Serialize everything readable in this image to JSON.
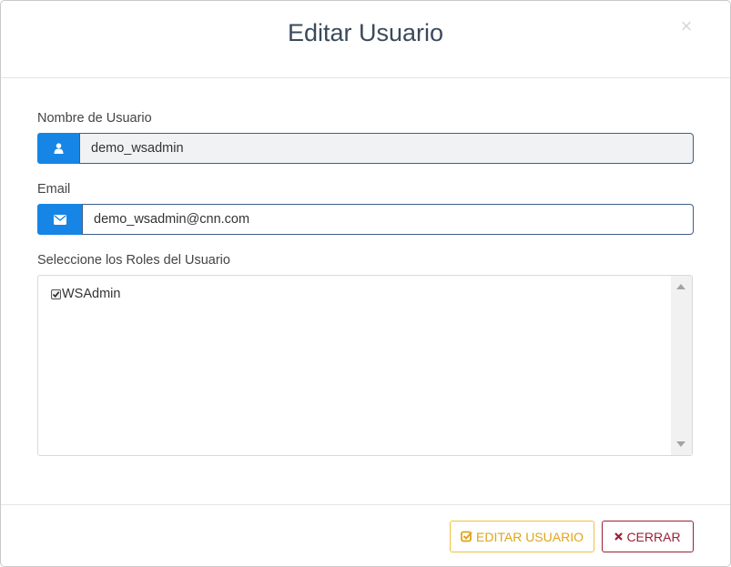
{
  "modal": {
    "title": "Editar Usuario",
    "close_glyph": "×"
  },
  "form": {
    "username": {
      "label": "Nombre de Usuario",
      "value": "demo_wsadmin",
      "icon": "user-icon",
      "readonly": true
    },
    "email": {
      "label": "Email",
      "value": "demo_wsadmin@cnn.com",
      "icon": "envelope-icon"
    },
    "roles": {
      "label": "Seleccione los Roles del Usuario",
      "items": [
        {
          "label": "WSAdmin",
          "checked": true
        }
      ]
    }
  },
  "footer": {
    "edit_label": "EDITAR USUARIO",
    "close_label": "CERRAR"
  },
  "colors": {
    "addon_blue": "#1685e6",
    "edit_yellow": "#e0a41a",
    "close_red": "#9a1f35",
    "title": "#3a4a5c"
  }
}
